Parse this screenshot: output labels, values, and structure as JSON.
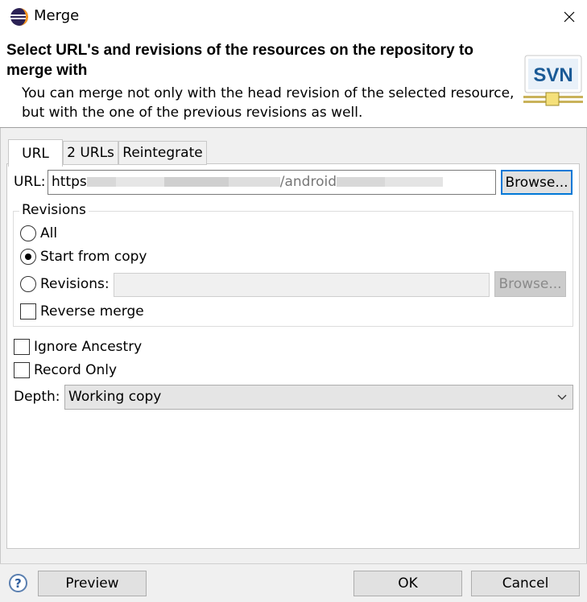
{
  "window": {
    "title": "Merge"
  },
  "header": {
    "title": "Select URL's and revisions of the resources on the repository to merge with",
    "description": "You can merge not only with the head revision of the selected resource, but with the one of the previous revisions as well.",
    "logo_text": "SVN"
  },
  "tabs": [
    {
      "label": "URL",
      "active": true
    },
    {
      "label": "2 URLs",
      "active": false
    },
    {
      "label": "Reintegrate",
      "active": false
    }
  ],
  "url_row": {
    "label": "URL:",
    "value_prefix": "https",
    "value_suffix": "/android",
    "browse_label": "Browse..."
  },
  "revisions": {
    "title": "Revisions",
    "options": [
      {
        "label": "All",
        "checked": false
      },
      {
        "label": "Start from copy",
        "checked": true
      },
      {
        "label": "Revisions:",
        "checked": false
      }
    ],
    "revisions_browse_label": "Browse...",
    "reverse_merge_label": "Reverse merge"
  },
  "options": {
    "ignore_ancestry_label": "Ignore Ancestry",
    "record_only_label": "Record Only"
  },
  "depth": {
    "label": "Depth:",
    "value": "Working copy"
  },
  "footer": {
    "help_symbol": "?",
    "preview_label": "Preview",
    "ok_label": "OK",
    "cancel_label": "Cancel"
  },
  "colors": {
    "focus_border": "#0078d7",
    "svn_logo_bg": "#1a5a96",
    "eclipse_purple": "#2c2255",
    "eclipse_orange": "#f7941e"
  }
}
